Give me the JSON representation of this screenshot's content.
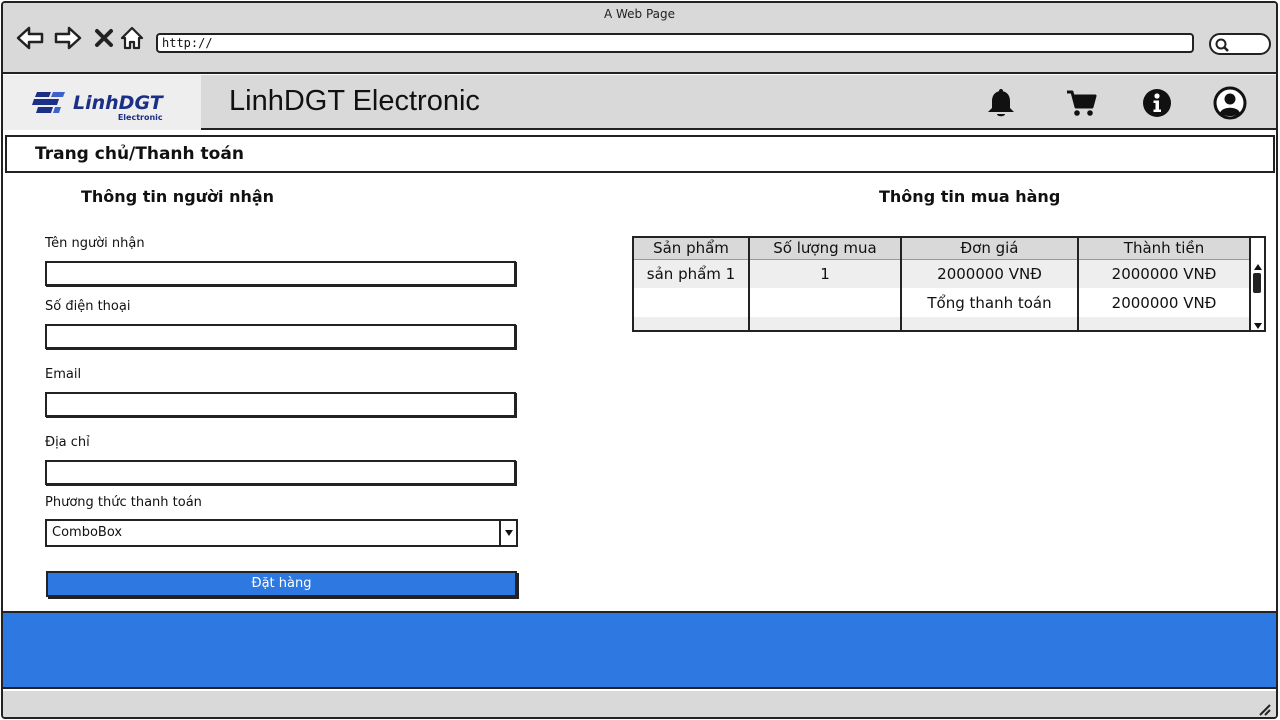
{
  "browser": {
    "window_title": "A Web Page",
    "address": "http://"
  },
  "header": {
    "logo_text": "LinhDGT",
    "logo_subtext": "Electronic",
    "brand": "LinhDGT Electronic",
    "icons": [
      "bell-icon",
      "cart-icon",
      "info-icon",
      "user-icon"
    ]
  },
  "breadcrumb": "Trang chủ/Thanh toán",
  "recipient": {
    "title": "Thông tin người nhận",
    "fields": [
      {
        "label": "Tên người nhận",
        "value": ""
      },
      {
        "label": "Số điện thoại",
        "value": ""
      },
      {
        "label": "Email",
        "value": ""
      },
      {
        "label": "Địa chỉ",
        "value": ""
      }
    ],
    "payment_label": "Phương thức thanh toán",
    "payment_value": "ComboBox",
    "submit_label": "Đặt hàng"
  },
  "purchase": {
    "title": "Thông tin mua hàng",
    "columns": [
      "Sản phẩm",
      "Số lượng mua",
      "Đơn giá",
      "Thành tiền"
    ],
    "rows": [
      [
        "sản phẩm 1",
        "1",
        "2000000 VNĐ",
        "2000000 VNĐ"
      ],
      [
        "",
        "",
        "Tổng thanh toán",
        "2000000 VNĐ"
      ]
    ]
  },
  "colors": {
    "accent": "#2e78e2",
    "chrome": "#d9d9d9",
    "logo": "#1c2f86"
  }
}
